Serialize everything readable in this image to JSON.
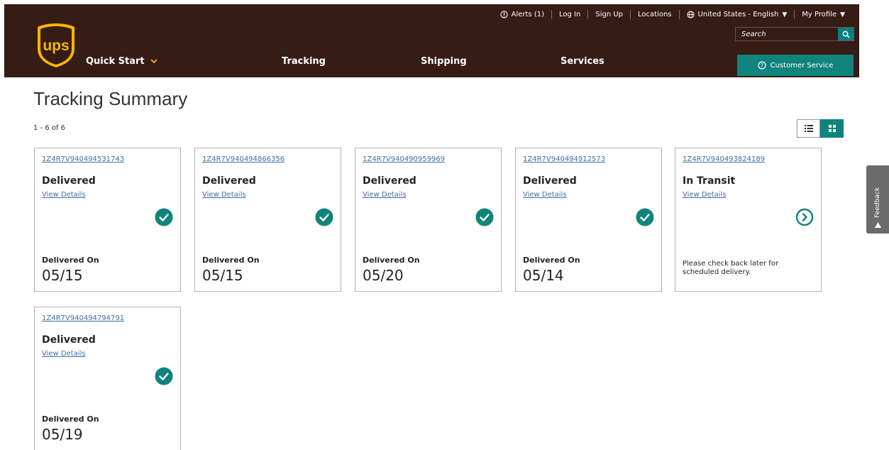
{
  "header": {
    "util_nav": {
      "alerts": "Alerts (1)",
      "login": "Log In",
      "signup": "Sign Up",
      "locations": "Locations",
      "locale": "United States - English",
      "profile": "My Profile"
    },
    "search": {
      "placeholder": "Search"
    },
    "customer_service": "Customer Service",
    "main_nav": {
      "quick_start": "Quick Start",
      "tracking": "Tracking",
      "shipping": "Shipping",
      "services": "Services"
    },
    "logo_text": "ups"
  },
  "page": {
    "title": "Tracking Summary",
    "count": "1 - 6 of 6"
  },
  "cards": [
    {
      "tracking": "1Z4R7V940494531743",
      "status": "Delivered",
      "details": "View Details",
      "date_label": "Delivered On",
      "date": "05/15"
    },
    {
      "tracking": "1Z4R7V940494866356",
      "status": "Delivered",
      "details": "View Details",
      "date_label": "Delivered On",
      "date": "05/15"
    },
    {
      "tracking": "1Z4R7V940490959969",
      "status": "Delivered",
      "details": "View Details",
      "date_label": "Delivered On",
      "date": "05/20"
    },
    {
      "tracking": "1Z4R7V940494912573",
      "status": "Delivered",
      "details": "View Details",
      "date_label": "Delivered On",
      "date": "05/14"
    },
    {
      "tracking": "1Z4R7V940493824189",
      "status": "In Transit",
      "details": "View Details",
      "message": "Please check back later for scheduled delivery."
    },
    {
      "tracking": "1Z4R7V940494794791",
      "status": "Delivered",
      "details": "View Details",
      "date_label": "Delivered On",
      "date": "05/19"
    }
  ],
  "feedback": "Feedback",
  "icons": {
    "delivered": "check-circle-icon",
    "in_transit": "arrow-right-circle-icon",
    "alerts": "alert-info-icon",
    "locale": "globe-icon",
    "search": "search-icon",
    "customer_service": "help-circle-icon",
    "list_view": "list-view-icon",
    "grid_view": "grid-view-icon"
  },
  "colors": {
    "brand_brown": "#351c15",
    "brand_gold": "#ffb500",
    "accent_teal": "#10837c",
    "link_blue": "#426da9"
  }
}
